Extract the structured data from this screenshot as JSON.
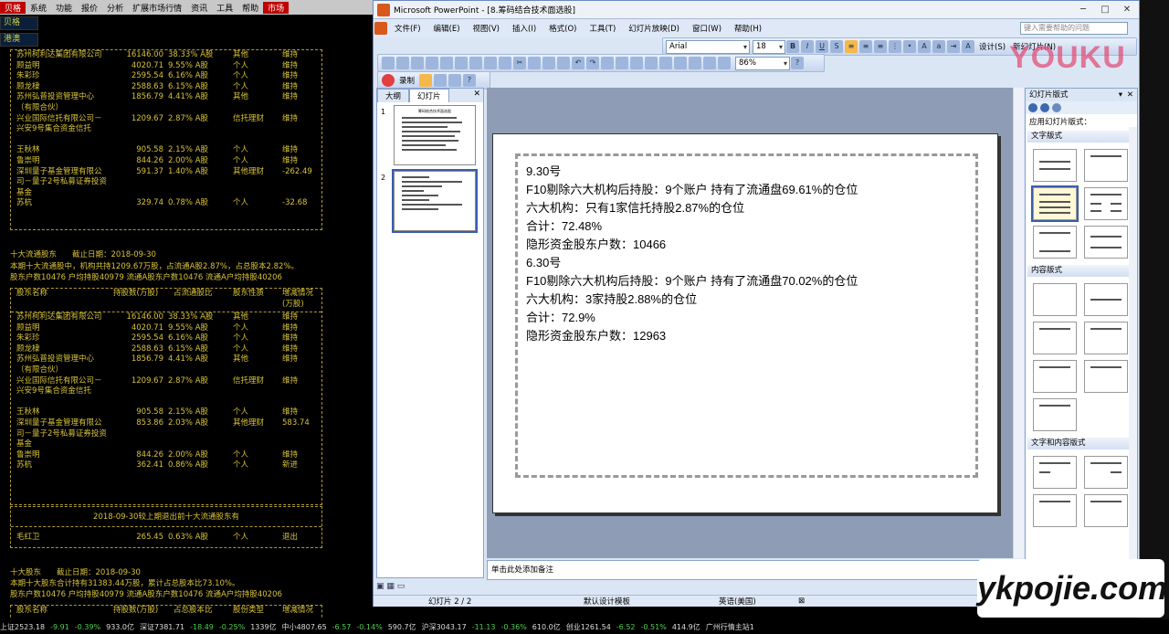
{
  "terminal": {
    "menu": [
      "贝格",
      "系统",
      "功能",
      "报价",
      "分析",
      "扩展市场行情",
      "资讯",
      "工具",
      "帮助",
      "市场"
    ],
    "tabs": [
      "贝格",
      "港澳"
    ],
    "table1": [
      {
        "name": "苏州柯利达集团有限公司",
        "qty": "16146.00",
        "pct": "38.33% A股",
        "type": "其他",
        "chg": "维持"
      },
      {
        "name": "顾益明",
        "qty": "4020.71",
        "pct": "9.55% A股",
        "type": "个人",
        "chg": "维持"
      },
      {
        "name": "朱彩珍",
        "qty": "2595.54",
        "pct": "6.16% A股",
        "type": "个人",
        "chg": "维持"
      },
      {
        "name": "顾龙棣",
        "qty": "2588.63",
        "pct": "6.15% A股",
        "type": "个人",
        "chg": "维持"
      },
      {
        "name": "苏州弘普投资管理中心（有限合伙）",
        "qty": "1856.79",
        "pct": "4.41% A股",
        "type": "其他",
        "chg": "维持"
      },
      {
        "name": "兴业国际信托有限公司－兴安9号集合资金信托",
        "qty": "1209.67",
        "pct": "2.87% A股",
        "type": "信托理财",
        "chg": "维持"
      },
      {
        "name": "王秋林",
        "qty": "905.58",
        "pct": "2.15% A股",
        "type": "个人",
        "chg": "维持"
      },
      {
        "name": "鲁崇明",
        "qty": "844.26",
        "pct": "2.00% A股",
        "type": "个人",
        "chg": "维持"
      },
      {
        "name": "深圳量子基金管理有限公司－量子2号私募证券投资基金",
        "qty": "591.37",
        "pct": "1.40% A股",
        "type": "其他理财",
        "chg": "-262.49"
      },
      {
        "name": "苏杭",
        "qty": "329.74",
        "pct": "0.78% A股",
        "type": "个人",
        "chg": "-32.68"
      }
    ],
    "section2_title": "十大流通股东　　截止日期：2018-09-30",
    "section2_line1": "本期十大流通股中，机构共持1209.67万股，占流通A股2.87%，占总股本2.82%。",
    "section2_line2": "股东户数10476 户均持股40979 流通A股东户数10476 流通A户均持股40206",
    "table2_head": [
      "股东名称",
      "持股数(万股)",
      "占流通股比",
      "股东性质",
      "增减情况(万股)"
    ],
    "table2": [
      {
        "name": "苏州柯利达集团有限公司",
        "qty": "16146.00",
        "pct": "38.33% A股",
        "type": "其他",
        "chg": "维持"
      },
      {
        "name": "顾益明",
        "qty": "4020.71",
        "pct": "9.55% A股",
        "type": "个人",
        "chg": "维持"
      },
      {
        "name": "朱彩珍",
        "qty": "2595.54",
        "pct": "6.16% A股",
        "type": "个人",
        "chg": "维持"
      },
      {
        "name": "顾龙棣",
        "qty": "2588.63",
        "pct": "6.15% A股",
        "type": "个人",
        "chg": "维持"
      },
      {
        "name": "苏州弘普投资管理中心（有限合伙）",
        "qty": "1856.79",
        "pct": "4.41% A股",
        "type": "其他",
        "chg": "维持"
      },
      {
        "name": "兴业国际信托有限公司－兴安9号集合资金信托",
        "qty": "1209.67",
        "pct": "2.87% A股",
        "type": "信托理财",
        "chg": "维持"
      },
      {
        "name": "王秋林",
        "qty": "905.58",
        "pct": "2.15% A股",
        "type": "个人",
        "chg": "维持"
      },
      {
        "name": "深圳量子基金管理有限公司－量子2号私募证券投资基金",
        "qty": "853.86",
        "pct": "2.03% A股",
        "type": "其他理财",
        "chg": "583.74"
      },
      {
        "name": "鲁崇明",
        "qty": "844.26",
        "pct": "2.00% A股",
        "type": "个人",
        "chg": "维持"
      },
      {
        "name": "苏杭",
        "qty": "362.41",
        "pct": "0.86% A股",
        "type": "个人",
        "chg": "新进"
      }
    ],
    "exit_title": "2018-09-30较上期退出前十大流通股东有",
    "exit_row": {
      "name": "毛红卫",
      "qty": "265.45",
      "pct": "0.63% A股",
      "type": "个人",
      "chg": "退出"
    },
    "section3_title": "十大股东　　截止日期：2018-09-30",
    "section3_line1": "本期十大股东合计持有31383.44万股，累计占总股本比73.10%。",
    "section3_line2": "股东户数10476 户均持股40979 流通A股东户数10476 流通A户均持股40206",
    "table3_head": [
      "股东名称",
      "持股数(万股)",
      "占总股本比",
      "股份类型",
      "增减情况"
    ],
    "status": [
      {
        "text": "上证2523.18",
        "cls": ""
      },
      {
        "text": "-9.91",
        "cls": "neg"
      },
      {
        "text": "-0.39%",
        "cls": "neg"
      },
      {
        "text": "933.0亿",
        "cls": ""
      },
      {
        "text": "深证7381.71",
        "cls": ""
      },
      {
        "text": "-18.49",
        "cls": "neg"
      },
      {
        "text": "-0.25%",
        "cls": "neg"
      },
      {
        "text": "1339亿",
        "cls": ""
      },
      {
        "text": "中小4807.65",
        "cls": ""
      },
      {
        "text": "-6.57",
        "cls": "neg"
      },
      {
        "text": "-0.14%",
        "cls": "neg"
      },
      {
        "text": "590.7亿",
        "cls": ""
      },
      {
        "text": "沪深3043.17",
        "cls": ""
      },
      {
        "text": "-11.13",
        "cls": "neg"
      },
      {
        "text": "-0.36%",
        "cls": "neg"
      },
      {
        "text": "610.0亿",
        "cls": ""
      },
      {
        "text": "创业1261.54",
        "cls": ""
      },
      {
        "text": "-6.52",
        "cls": "neg"
      },
      {
        "text": "-0.51%",
        "cls": "neg"
      },
      {
        "text": "414.9亿",
        "cls": ""
      },
      {
        "text": "广州行情主站1",
        "cls": ""
      }
    ]
  },
  "ppt": {
    "title": "Microsoft PowerPoint - [8.筹码结合技术面选股]",
    "menu": [
      "文件(F)",
      "编辑(E)",
      "视图(V)",
      "插入(I)",
      "格式(O)",
      "工具(T)",
      "幻灯片放映(D)",
      "窗口(W)",
      "帮助(H)"
    ],
    "help_placeholder": "键入需要帮助的问题",
    "font_name": "Arial",
    "font_size": "18",
    "zoom": "86%",
    "design_label": "设计(S)",
    "new_slide_label": "新幻灯片(N)",
    "record_label": "录制",
    "pane_tabs": [
      "大纲",
      "幻灯片"
    ],
    "thumb1_title": "筹码结合技术面选股",
    "slide_lines": [
      "9.30号",
      "F10剔除六大机构后持股：9个账户 持有了流通盘69.61%的仓位",
      "六大机构：只有1家信托持股2.87%的仓位",
      "合计：72.48%",
      "隐形资金股东户数：10466",
      "6.30号",
      "F10剔除六大机构后持股：9个账户 持有了流通盘70.02%的仓位",
      "六大机构：3家持股2.88%的仓位",
      "合计：72.9%",
      "隐形资金股东户数：12963"
    ],
    "notes_placeholder": "单击此处添加备注",
    "status_slide": "幻灯片 2 / 2",
    "status_template": "默认设计模板",
    "status_lang": "英语(美国)",
    "taskpane": {
      "title": "幻灯片版式",
      "subtitle": "应用幻灯片版式：",
      "sections": [
        "文字版式",
        "内容版式",
        "文字和内容版式"
      ]
    }
  },
  "watermarks": {
    "youku": "YOUKU",
    "site": "ykpojie.com"
  }
}
